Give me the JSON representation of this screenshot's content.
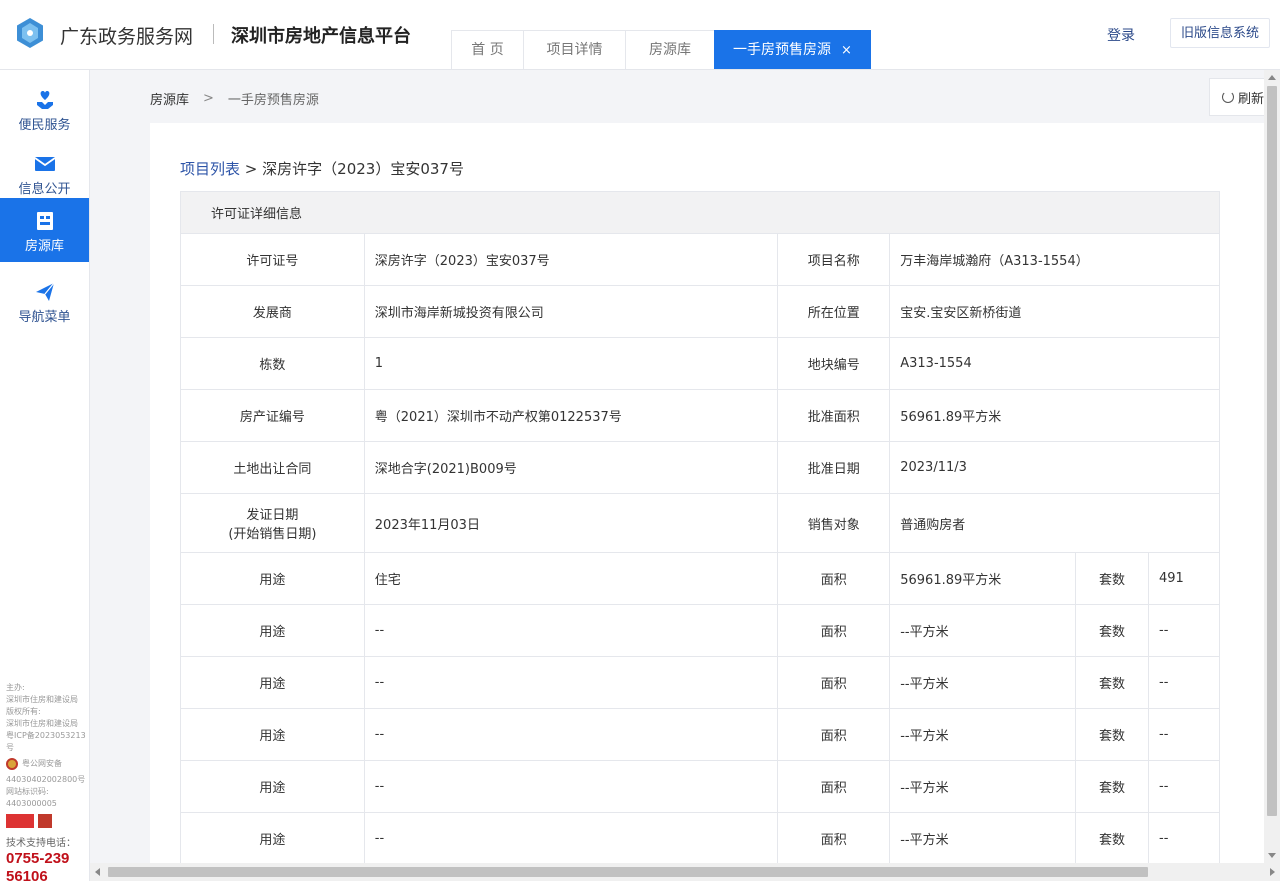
{
  "header": {
    "site_name": "广东政务服务网",
    "platform_name": "深圳市房地产信息平台",
    "tabs": [
      {
        "label": "首 页"
      },
      {
        "label": "项目详情"
      },
      {
        "label": "房源库"
      },
      {
        "label": "一手房预售房源",
        "close": "×"
      }
    ],
    "login": "登录",
    "old_system": "旧版信息系统"
  },
  "sidebar": {
    "items": [
      {
        "label": "便民服务",
        "icon": "heart-hand-icon"
      },
      {
        "label": "信息公开",
        "icon": "mail-icon"
      },
      {
        "label": "房源库",
        "icon": "house-icon"
      },
      {
        "label": "导航菜单",
        "icon": "paper-plane-icon"
      }
    ],
    "footer": {
      "lines1": [
        "主办:",
        "深圳市住房和建设局",
        "版权所有:",
        "深圳市住房和建设局",
        "粤ICP备2023053213号"
      ],
      "police": "粤公网安备",
      "lines2": [
        "44030402002800号",
        "网站标识码:",
        "4403000005"
      ],
      "tech_label": "技术支持电话：",
      "phone_line1": "0755-239",
      "phone_line2": "56106"
    }
  },
  "breadcrumb": {
    "root": "房源库",
    "sep": ">",
    "current": "一手房预售房源"
  },
  "refresh": "刷新",
  "detail": {
    "list_link": "项目列表",
    "sep": ">",
    "permit_title": "深房许字（2023）宝安037号",
    "section_title": "许可证详细信息",
    "rows": [
      {
        "k1": "许可证号",
        "v1": "深房许字（2023）宝安037号",
        "k2": "项目名称",
        "v2": "万丰海岸城瀚府（A313-1554）"
      },
      {
        "k1": "发展商",
        "v1": "深圳市海岸新城投资有限公司",
        "k2": "所在位置",
        "v2": "宝安.宝安区新桥街道"
      },
      {
        "k1": "栋数",
        "v1": "1",
        "k2": "地块编号",
        "v2": "A313-1554"
      },
      {
        "k1": "房产证编号",
        "v1": "粤（2021）深圳市不动产权第0122537号",
        "k2": "批准面积",
        "v2": "56961.89平方米"
      },
      {
        "k1": "土地出让合同",
        "v1": "深地合字(2021)B009号",
        "k2": "批准日期",
        "v2": "2023/11/3"
      }
    ],
    "issue_row": {
      "k1a": "发证日期",
      "k1b": "(开始销售日期)",
      "v1": "2023年11月03日",
      "k2": "销售对象",
      "v2": "普通购房者"
    },
    "usage_rows": [
      {
        "k1": "用途",
        "v1": "住宅",
        "k2": "面积",
        "v2": "56961.89平方米",
        "k3": "套数",
        "v3": "491"
      },
      {
        "k1": "用途",
        "v1": "--",
        "k2": "面积",
        "v2": "--平方米",
        "k3": "套数",
        "v3": "--"
      },
      {
        "k1": "用途",
        "v1": "--",
        "k2": "面积",
        "v2": "--平方米",
        "k3": "套数",
        "v3": "--"
      },
      {
        "k1": "用途",
        "v1": "--",
        "k2": "面积",
        "v2": "--平方米",
        "k3": "套数",
        "v3": "--"
      },
      {
        "k1": "用途",
        "v1": "--",
        "k2": "面积",
        "v2": "--平方米",
        "k3": "套数",
        "v3": "--"
      },
      {
        "k1": "用途",
        "v1": "--",
        "k2": "面积",
        "v2": "--平方米",
        "k3": "套数",
        "v3": "--"
      }
    ]
  },
  "colors": {
    "accent": "#1a73e8",
    "link": "#2e55a8",
    "phone": "#c0101a"
  }
}
